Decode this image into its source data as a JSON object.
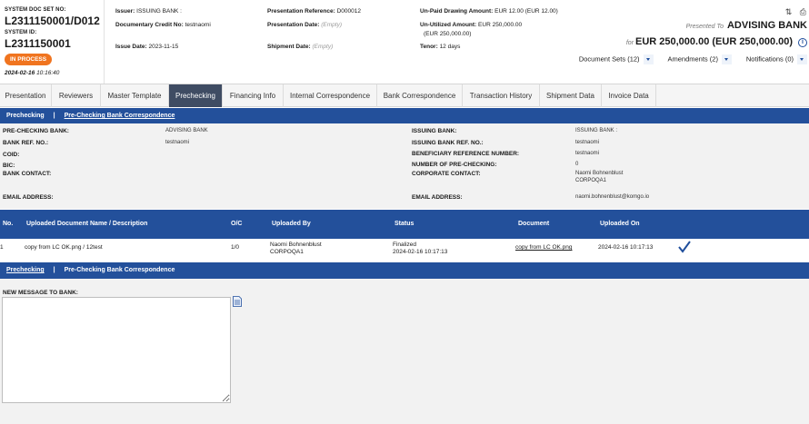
{
  "header": {
    "sys_doc_set_label": "SYSTEM DOC SET NO:",
    "sys_doc_set_value": "L2311150001/D012",
    "sys_id_label": "SYSTEM ID:",
    "sys_id_value": "L2311150001",
    "status_badge": "IN PROCESS",
    "date": "2024-02-16",
    "time": "10:16:40",
    "issuer_label": "Issuer:",
    "issuer_value": "ISSUING BANK :",
    "dc_no_label": "Documentary Credit No:",
    "dc_no_value": "testnaomi",
    "issue_date_label": "Issue Date:",
    "issue_date_value": "2023-11-15",
    "pres_ref_label": "Presentation Reference:",
    "pres_ref_value": "D000012",
    "pres_date_label": "Presentation Date:",
    "pres_date_value": "(Empty)",
    "ship_date_label": "Shipment Date:",
    "ship_date_value": "(Empty)",
    "unpaid_label": "Un-Paid Drawing Amount:",
    "unpaid_value": "EUR 12.00   (EUR 12.00)",
    "unutil_label": "Un-Utilized Amount:",
    "unutil_value": "EUR 250,000.00",
    "unutil_value2": "(EUR 250,000.00)",
    "tenor_label": "Tenor:",
    "tenor_value": "12 days",
    "presented_to_label": "Presented To",
    "presented_to_value": "ADVISING BANK",
    "for_label": "for",
    "amount": "EUR 250,000.00 (EUR 250,000.00)",
    "doc_sets_label": "Document Sets (12)",
    "amendments_label": "Amendments (2)",
    "notifications_label": "Notifications (0)"
  },
  "tabs": [
    {
      "label": "Presentation"
    },
    {
      "label": "Reviewers"
    },
    {
      "label": "Master Template"
    },
    {
      "label": "Prechecking"
    },
    {
      "label": "Financing Info"
    },
    {
      "label": "Internal Correspondence"
    },
    {
      "label": "Bank Correspondence"
    },
    {
      "label": "Transaction History"
    },
    {
      "label": "Shipment Data"
    },
    {
      "label": "Invoice Data"
    }
  ],
  "subbar1": {
    "item1": "Prechecking",
    "sep": "|",
    "item2": "Pre-Checking Bank Correspondence"
  },
  "info": {
    "prechecking_bank_label": "PRE-CHECKING BANK:",
    "prechecking_bank_value": "ADVISING BANK",
    "bank_ref_label": "BANK REF. NO.:",
    "bank_ref_value": "testnaomi",
    "coid_label": "COID:",
    "bic_label": "BIC:",
    "bank_contact_label": "BANK CONTACT:",
    "email_left_label": "EMAIL ADDRESS:",
    "issuing_bank_label": "ISSUING BANK:",
    "issuing_bank_value": "ISSUING BANK :",
    "issuing_ref_label": "ISSUING BANK REF. NO.:",
    "issuing_ref_value": "testnaomi",
    "benef_ref_label": "BENEFICIARY REFERENCE NUMBER:",
    "benef_ref_value": "testnaomi",
    "num_prechecking_label": "NUMBER OF PRE-CHECKING:",
    "num_prechecking_value": "0",
    "corp_contact_label": "CORPORATE CONTACT:",
    "corp_contact_value1": "Naomi Bohnenblust",
    "corp_contact_value2": "CORPOQA1",
    "email_right_label": "EMAIL ADDRESS:",
    "email_right_value": "naomi.bohnenblust@komgo.io"
  },
  "table": {
    "headers": [
      "No.",
      "Uploaded Document Name / Description",
      "O/C",
      "Uploaded By",
      "Status",
      "Document",
      "Uploaded On"
    ],
    "rows": [
      {
        "no": "1",
        "name": "copy from LC OK.png / 12test",
        "oc": "1/0",
        "by1": "Naomi Bohnenblust",
        "by2": "CORPOQA1",
        "status1": "Finalized",
        "status2": "2024-02-16 10:17:13",
        "document": "copy from LC OK.png",
        "uploaded_on": "2024-02-16 10:17:13"
      }
    ]
  },
  "subbar2": {
    "item1": "Prechecking",
    "sep": "|",
    "item2": "Pre-Checking Bank Correspondence"
  },
  "message": {
    "label": "NEW MESSAGE TO BANK:",
    "value": ""
  },
  "colors": {
    "primary_blue": "#23509b",
    "active_tab": "#3f4c63",
    "badge_orange": "#f0741f"
  }
}
